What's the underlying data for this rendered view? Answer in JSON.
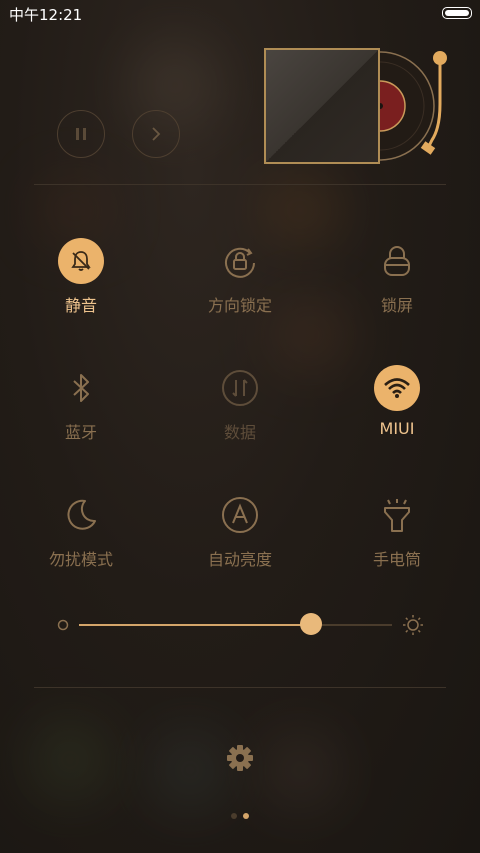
{
  "status_bar": {
    "time": "中午12:21"
  },
  "media": {
    "pause_icon": "pause-icon",
    "next_icon": "chevron-right-icon"
  },
  "toggles": [
    {
      "label": "静音",
      "icon": "bell-off-icon",
      "active": true
    },
    {
      "label": "方向锁定",
      "icon": "rotation-lock-icon",
      "active": false
    },
    {
      "label": "锁屏",
      "icon": "lock-icon",
      "active": false
    },
    {
      "label": "蓝牙",
      "icon": "bluetooth-icon",
      "active": false
    },
    {
      "label": "数据",
      "icon": "data-icon",
      "active": false,
      "disabled": true
    },
    {
      "label": "MIUI",
      "icon": "wifi-icon",
      "active": true
    },
    {
      "label": "勿扰模式",
      "icon": "moon-icon",
      "active": false
    },
    {
      "label": "自动亮度",
      "icon": "auto-brightness-icon",
      "active": false
    },
    {
      "label": "手电筒",
      "icon": "flashlight-icon",
      "active": false
    }
  ],
  "brightness": {
    "value_fraction": 0.74
  },
  "settings": {
    "icon": "gear-icon"
  },
  "pager": {
    "pages": 2,
    "current": 2
  },
  "colors": {
    "accent": "#ebb36b",
    "muted": "#8a7050",
    "background": "#1f1914"
  }
}
